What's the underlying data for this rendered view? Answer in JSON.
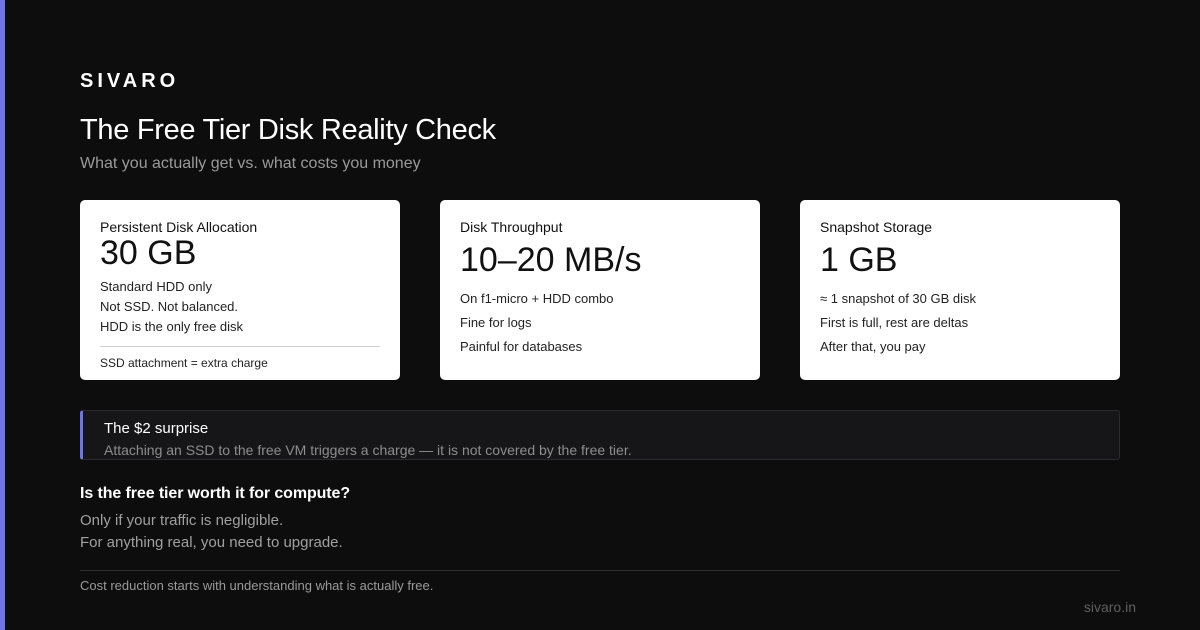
{
  "brand": "SIVARO",
  "title": "The Free Tier Disk Reality Check",
  "subtitle": "What you actually get vs. what costs you money",
  "colors": {
    "background": "#0d0d0d",
    "accent": "#6f74e8",
    "card": "#ffffff"
  },
  "cards": [
    {
      "label": "Persistent Disk Allocation",
      "value": "30 GB",
      "lines": [
        "Standard HDD only",
        "Not SSD. Not balanced.",
        "HDD is the only free disk"
      ],
      "note": "SSD attachment = extra charge"
    },
    {
      "label": "Disk Throughput",
      "value": "10–20 MB/s",
      "lines": [
        "On f1-micro + HDD combo",
        "Fine for logs",
        "Painful for databases"
      ]
    },
    {
      "label": "Snapshot Storage",
      "value": "1 GB",
      "lines": [
        "≈ 1 snapshot of 30 GB disk",
        "First is full, rest are deltas",
        "After that, you pay"
      ]
    }
  ],
  "callout": {
    "title": "The $2 surprise",
    "text": "Attaching an SSD to the free VM triggers a charge — it is not covered by the free tier."
  },
  "question": "Is the free tier worth it for compute?",
  "answer": [
    "Only if your traffic is negligible.",
    "For anything real, you need to upgrade."
  ],
  "footer": {
    "note": "Cost reduction starts with understanding what is actually free.",
    "url": "sivaro.in"
  }
}
